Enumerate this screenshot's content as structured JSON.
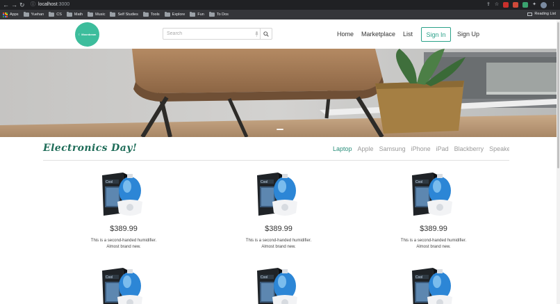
{
  "browser": {
    "url_host": "localhost",
    "url_port": ":3000",
    "reading_list": "Reading List",
    "bookmarks": [
      {
        "label": "Apps",
        "icon": "apps-grid-icon"
      },
      {
        "label": "Yuehan",
        "icon": "folder-icon"
      },
      {
        "label": "CS",
        "icon": "folder-icon"
      },
      {
        "label": "Math",
        "icon": "folder-icon"
      },
      {
        "label": "Music",
        "icon": "folder-icon"
      },
      {
        "label": "Self Studies",
        "icon": "folder-icon"
      },
      {
        "label": "Tools",
        "icon": "folder-icon"
      },
      {
        "label": "Explore",
        "icon": "folder-icon"
      },
      {
        "label": "Fun",
        "icon": "folder-icon"
      },
      {
        "label": "To Dos",
        "icon": "folder-icon"
      }
    ]
  },
  "header": {
    "logo_text": "Moonbeam",
    "search_placeholder": "Search",
    "nav": {
      "home": "Home",
      "marketplace": "Marketplace",
      "list": "List",
      "sign_in": "Sign In",
      "sign_up": "Sign Up"
    }
  },
  "section": {
    "title": "Electronics Day!",
    "tabs": [
      "Laptop",
      "Apple",
      "Samsung",
      "iPhone",
      "iPad",
      "Blackberry",
      "Speaker"
    ],
    "active_tab": "Laptop"
  },
  "products": [
    {
      "price": "$389.99",
      "description": "This is a second-handed humidifier. Almost brand new."
    },
    {
      "price": "$389.99",
      "description": "This is a second-handed humidifier. Almost brand new."
    },
    {
      "price": "$389.99",
      "description": "This is a second-handed humidifier. Almost brand new."
    },
    {
      "price": "",
      "description": ""
    },
    {
      "price": "",
      "description": ""
    },
    {
      "price": "",
      "description": ""
    }
  ],
  "colors": {
    "accent": "#2aa189",
    "logo_bg": "#3dbd9c",
    "title": "#1e6c58"
  }
}
